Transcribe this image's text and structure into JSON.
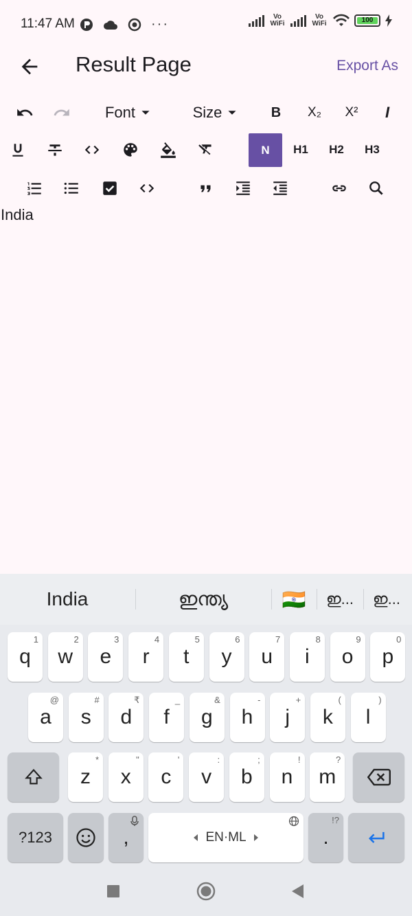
{
  "status_bar": {
    "time": "11:47 AM",
    "vowifi_1": "Vo WiFi",
    "vowifi_2": "Vo WiFi",
    "battery_level": "100"
  },
  "app_bar": {
    "title": "Result Page",
    "export_label": "Export As"
  },
  "toolbar": {
    "font_label": "Font",
    "size_label": "Size",
    "bold_label": "B",
    "subscript_label": "X₂",
    "superscript_label": "X²",
    "italic_label": "I",
    "normal_label": "N",
    "h1_label": "H1",
    "h2_label": "H2",
    "h3_label": "H3"
  },
  "editor": {
    "content": "India"
  },
  "keyboard": {
    "suggestions": [
      "India",
      "ഇന്ത്യ",
      "🇮🇳",
      "ഇ...",
      "ഇ..."
    ],
    "row1": [
      {
        "k": "q",
        "h": "1"
      },
      {
        "k": "w",
        "h": "2"
      },
      {
        "k": "e",
        "h": "3"
      },
      {
        "k": "r",
        "h": "4"
      },
      {
        "k": "t",
        "h": "5"
      },
      {
        "k": "y",
        "h": "6"
      },
      {
        "k": "u",
        "h": "7"
      },
      {
        "k": "i",
        "h": "8"
      },
      {
        "k": "o",
        "h": "9"
      },
      {
        "k": "p",
        "h": "0"
      }
    ],
    "row2": [
      {
        "k": "a",
        "h": "@"
      },
      {
        "k": "s",
        "h": "#"
      },
      {
        "k": "d",
        "h": "₹"
      },
      {
        "k": "f",
        "h": "_"
      },
      {
        "k": "g",
        "h": "&"
      },
      {
        "k": "h",
        "h": "-"
      },
      {
        "k": "j",
        "h": "+"
      },
      {
        "k": "k",
        "h": "("
      },
      {
        "k": "l",
        "h": ")"
      }
    ],
    "row3": [
      {
        "k": "z",
        "h": "*"
      },
      {
        "k": "x",
        "h": "\""
      },
      {
        "k": "c",
        "h": "'"
      },
      {
        "k": "v",
        "h": ":"
      },
      {
        "k": "b",
        "h": ";"
      },
      {
        "k": "n",
        "h": "!"
      },
      {
        "k": "m",
        "h": "?"
      }
    ],
    "symbols_label": "?123",
    "comma_label": ",",
    "space_label": "EN·ML",
    "period_label": ".",
    "period_hint": "!?"
  },
  "colors": {
    "accent": "#6750a4",
    "background": "#fff7fa",
    "keyboard_bg": "#e8eaee",
    "enter_blue": "#1a73e8"
  }
}
